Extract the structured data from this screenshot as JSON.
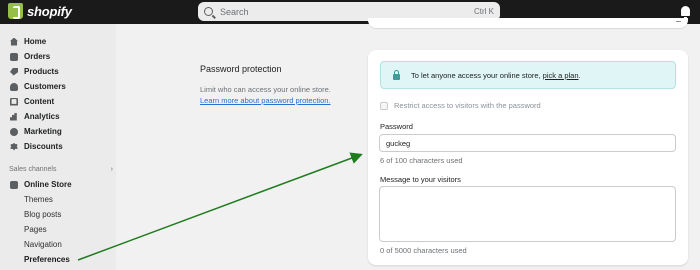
{
  "topbar": {
    "brand": "shopify",
    "search_placeholder": "Search",
    "search_shortcut": "Ctrl K"
  },
  "sidebar": {
    "items": [
      {
        "label": "Home",
        "icon": "home-icon"
      },
      {
        "label": "Orders",
        "icon": "orders-icon"
      },
      {
        "label": "Products",
        "icon": "tag-icon"
      },
      {
        "label": "Customers",
        "icon": "person-icon"
      },
      {
        "label": "Content",
        "icon": "content-icon"
      },
      {
        "label": "Analytics",
        "icon": "bar-chart-icon"
      },
      {
        "label": "Marketing",
        "icon": "target-icon"
      },
      {
        "label": "Discounts",
        "icon": "discount-icon"
      }
    ],
    "sales_channels_label": "Sales channels",
    "online_store_label": "Online Store",
    "sub_items": [
      "Themes",
      "Blog posts",
      "Pages",
      "Navigation",
      "Preferences"
    ],
    "active_sub_item": "Preferences"
  },
  "section": {
    "title": "Password protection",
    "description": "Limit who can access your online store.",
    "learn_more_link": "Learn more about password protection."
  },
  "card": {
    "banner_text": "To let anyone access your online store,",
    "banner_link": "pick a plan",
    "banner_end": ".",
    "restrict_label": "Restrict access to visitors with the password",
    "restrict_checked": false,
    "password_label": "Password",
    "password_value": "guckeg",
    "password_help": "6 of 100 characters used",
    "message_label": "Message to your visitors",
    "message_value": "",
    "message_help": "0 of 5000 characters used"
  },
  "colors": {
    "topbar": "#1a1a1a",
    "brand_green": "#95bf47",
    "banner_bg": "#e0f5f5",
    "link": "#2c6ecb",
    "annotation_arrow": "#1e7b1e"
  }
}
